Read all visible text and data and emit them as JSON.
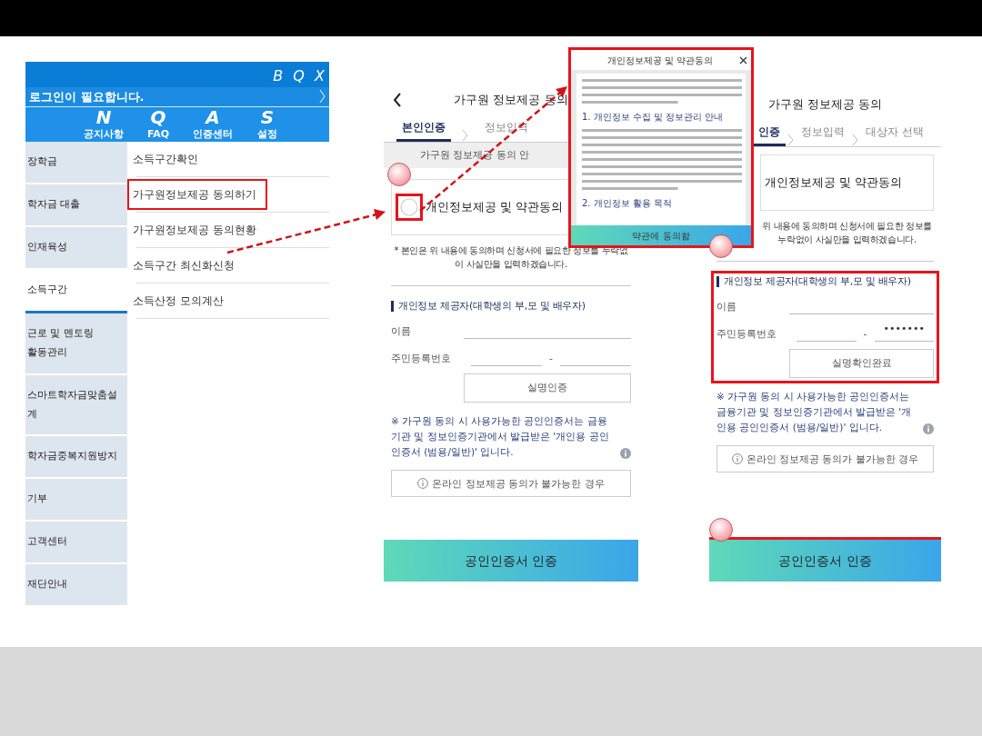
{
  "menu_screen": {
    "header_text": "B Q X",
    "login_text": "로그인이 필요합니다.",
    "quick_links": [
      {
        "letter": "N",
        "label": "공지사항"
      },
      {
        "letter": "Q",
        "label": "FAQ"
      },
      {
        "letter": "A",
        "label": "인증센터"
      },
      {
        "letter": "S",
        "label": "설정"
      }
    ],
    "categories": [
      {
        "label": "장학금",
        "selected": false
      },
      {
        "label": "학자금 대출",
        "selected": false
      },
      {
        "label": "인재육성",
        "selected": false
      },
      {
        "label": "소득구간",
        "selected": true
      },
      {
        "label": "근로 및 멘토링\n활동관리",
        "selected": false
      },
      {
        "label": "스마트학자금맞춤설계",
        "selected": false
      },
      {
        "label": "학자금중복지원방지",
        "selected": false
      },
      {
        "label": "기부",
        "selected": false
      },
      {
        "label": "고객센터",
        "selected": false
      },
      {
        "label": "재단안내",
        "selected": false
      }
    ],
    "submenu": [
      {
        "label": "소득구간확인",
        "highlighted": false
      },
      {
        "label": "가구원정보제공 동의하기",
        "highlighted": true
      },
      {
        "label": "가구원정보제공 동의현황",
        "highlighted": false
      },
      {
        "label": "소득구간 최신화신청",
        "highlighted": false
      },
      {
        "label": "소득산정 모의계산",
        "highlighted": false
      }
    ]
  },
  "consent_screens": [
    {
      "has_back": true,
      "title": "가구원 정보제공 동의",
      "tabs": [
        {
          "label": "본인인증",
          "selected": true
        },
        {
          "label": "정보입력",
          "selected": false
        }
      ],
      "band": "가구원 정보제공 동의 안",
      "agree": {
        "label": "개인정보제공 및 약관동의",
        "checked": false,
        "highlighted": true
      },
      "pledge": "* 본인은 위 내용에 동의하며 신청서에 필요한 정보를 누락없이 사실만을 입력하겠습니다.",
      "section": {
        "title": "개인정보 제공자(대학생의 부,모 및 배우자)",
        "highlighted": false
      },
      "name_label": "이름",
      "rrn_label": "주민등록번호",
      "rrn_separator": "-",
      "verify_button": "실명인증",
      "notice": "※ 가구원 동의 시 사용가능한 공인인증서는 금융기관 및 정보인증기관에서 발급받은 '개인용 공인인증서 (범용/일반)' 입니다.",
      "offline_button": "온라인 정보제공 동의가 불가능한 경우",
      "main_button": {
        "label": "공인인증서 인증",
        "highlighted": false
      }
    },
    {
      "has_back": false,
      "title": "가구원 정보제공 동의",
      "tabs": [
        {
          "label": "인증",
          "selected": true
        },
        {
          "label": "정보입력",
          "selected": false
        },
        {
          "label": "대상자 선택",
          "selected": false
        }
      ],
      "agree": {
        "label": "개인정보제공 및 약관동의"
      },
      "pledge": "위 내용에 동의하며 신청서에 필요한 정보를 누락없이 사실만을 입력하겠습니다.",
      "section": {
        "title": "개인정보 제공자(대학생의 부,모 및 배우자)",
        "highlighted": true
      },
      "name_label": "이름",
      "rrn_label": "주민등록번호",
      "rrn_separator": "-",
      "rrn_value": "•••••••",
      "verify_button": "실명확인완료",
      "notice": "※ 가구원 동의 시 사용가능한 공인인증서는 금융기관 및 정보인증기관에서 발급받은 '개인용 공인인증서 (범용/일반)' 입니다.",
      "offline_button": "온라인 정보제공 동의가 불가능한 경우",
      "main_button": {
        "label": "공인인증서 인증",
        "highlighted": true
      }
    }
  ],
  "terms_popup": {
    "title": "개인정보제공 및 약관동의",
    "headings": [
      "1. 개인정보 수집 및 정보관리 안내",
      "2. 개인정보 활용 목적"
    ],
    "agree_button": "약관에 동의함"
  }
}
